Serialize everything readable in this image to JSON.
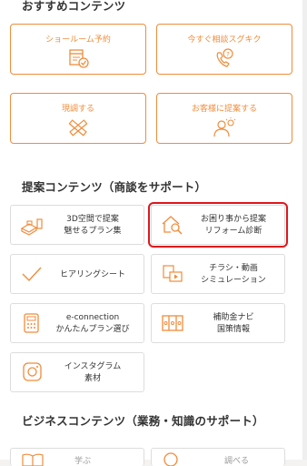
{
  "recommended": {
    "title": "おすすめコンテンツ",
    "cards": [
      {
        "label": "ショールーム予約",
        "icon": "calendar-check-icon"
      },
      {
        "label": "今すぐ相談スグキク",
        "icon": "phone-question-icon"
      },
      {
        "label": "現調する",
        "icon": "ruler-pencil-icon"
      },
      {
        "label": "お客様に提案する",
        "icon": "person-idea-icon"
      }
    ]
  },
  "proposal": {
    "title": "提案コンテンツ（商談をサポート）",
    "items": [
      {
        "line1": "3D空間で提案",
        "line2": "魅せるプラン集",
        "icon": "3d-plan-icon"
      },
      {
        "line1": "お困り事から提案",
        "line2": "リフォーム診断",
        "icon": "house-search-icon"
      },
      {
        "line1": "ヒアリングシート",
        "line2": "",
        "icon": "checkmark-icon"
      },
      {
        "line1": "チラシ・動画",
        "line2": "シミュレーション",
        "icon": "flyer-video-icon"
      },
      {
        "line1": "e-connection",
        "line2": "かんたんプラン選び",
        "icon": "calculator-icon"
      },
      {
        "line1": "補助金ナビ",
        "line2": "国策情報",
        "icon": "subsidy-icon"
      },
      {
        "line1": "インスタグラム",
        "line2": "素材",
        "icon": "instagram-icon"
      }
    ]
  },
  "business": {
    "title": "ビジネスコンテンツ（業務・知識のサポート）",
    "items": [
      {
        "label": "学ぶ"
      },
      {
        "label": "調べる"
      }
    ]
  },
  "colors": {
    "accent": "#f08c3b",
    "highlight": "#e0161b"
  }
}
